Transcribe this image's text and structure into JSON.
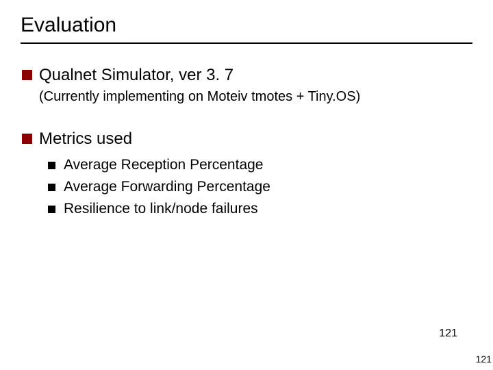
{
  "title": "Evaluation",
  "items": [
    {
      "label": "Qualnet Simulator, ver 3. 7",
      "subtext": "(Currently implementing on Moteiv tmotes + Tiny.OS)"
    },
    {
      "label": "Metrics used",
      "children": [
        "Average Reception Percentage",
        "Average Forwarding Percentage",
        "Resilience to link/node failures"
      ]
    }
  ],
  "page_number_inner": "121",
  "page_number_outer": "121"
}
